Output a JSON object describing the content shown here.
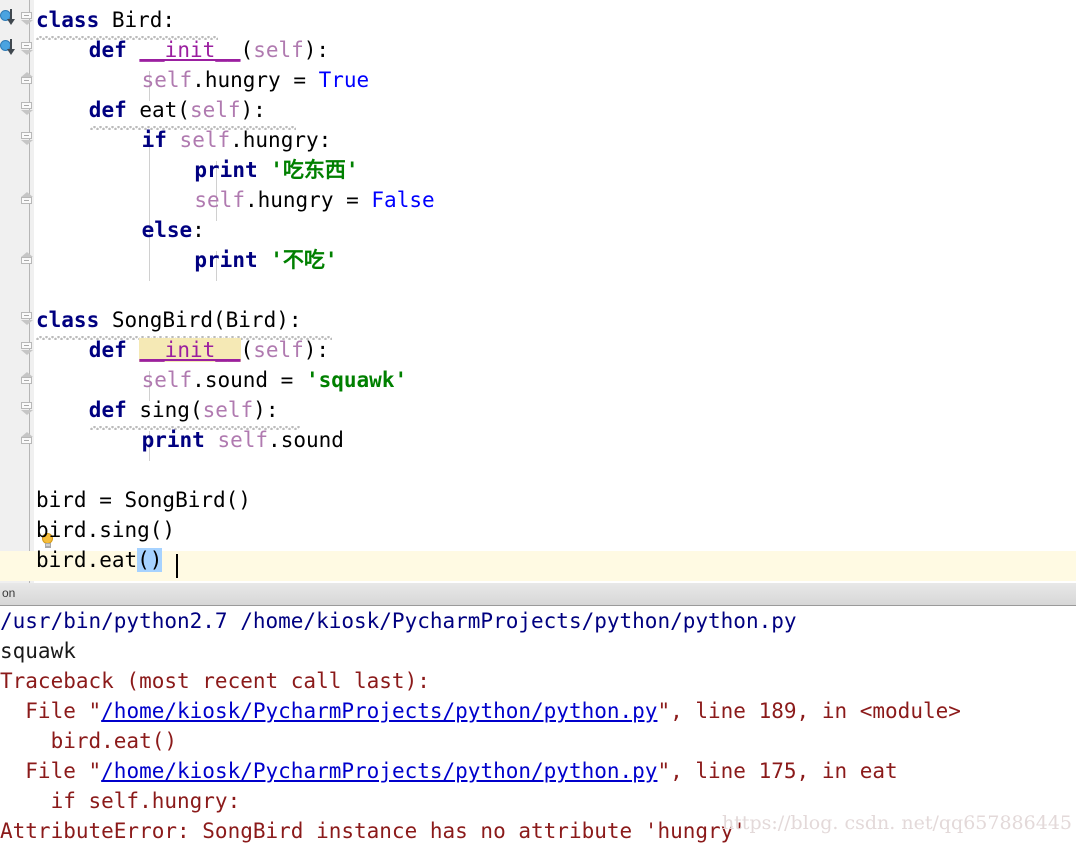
{
  "editor": {
    "language": "Python",
    "caret_row_highlight_color": "#fffae3",
    "selection_color": "#a6d2ff",
    "lines": [
      {
        "n": 1,
        "indent": 0,
        "tokens": [
          {
            "t": "class",
            "c": "kw"
          },
          {
            "t": " Bird:",
            "c": "plain"
          }
        ]
      },
      {
        "n": 2,
        "indent": 1,
        "tokens": [
          {
            "t": "def",
            "c": "kw"
          },
          {
            "t": " ",
            "c": "plain"
          },
          {
            "t": "__init__",
            "c": "dunder"
          },
          {
            "t": "(",
            "c": "plain"
          },
          {
            "t": "self",
            "c": "selfid"
          },
          {
            "t": "):",
            "c": "plain"
          }
        ]
      },
      {
        "n": 3,
        "indent": 2,
        "tokens": [
          {
            "t": "self",
            "c": "selfid"
          },
          {
            "t": ".hungry = ",
            "c": "plain"
          },
          {
            "t": "True",
            "c": "bool"
          }
        ]
      },
      {
        "n": 4,
        "indent": 1,
        "tokens": [
          {
            "t": "def",
            "c": "kw"
          },
          {
            "t": " eat(",
            "c": "plain"
          },
          {
            "t": "self",
            "c": "selfid"
          },
          {
            "t": "):",
            "c": "plain"
          }
        ]
      },
      {
        "n": 5,
        "indent": 2,
        "tokens": [
          {
            "t": "if",
            "c": "kw"
          },
          {
            "t": " ",
            "c": "plain"
          },
          {
            "t": "self",
            "c": "selfid"
          },
          {
            "t": ".hungry:",
            "c": "plain"
          }
        ]
      },
      {
        "n": 6,
        "indent": 3,
        "tokens": [
          {
            "t": "print",
            "c": "kw"
          },
          {
            "t": " ",
            "c": "plain"
          },
          {
            "t": "'吃东西'",
            "c": "str"
          }
        ]
      },
      {
        "n": 7,
        "indent": 3,
        "tokens": [
          {
            "t": "self",
            "c": "selfid"
          },
          {
            "t": ".hungry = ",
            "c": "plain"
          },
          {
            "t": "False",
            "c": "bool"
          }
        ]
      },
      {
        "n": 8,
        "indent": 2,
        "tokens": [
          {
            "t": "else",
            "c": "kw"
          },
          {
            "t": ":",
            "c": "plain"
          }
        ]
      },
      {
        "n": 9,
        "indent": 3,
        "tokens": [
          {
            "t": "print",
            "c": "kw"
          },
          {
            "t": " ",
            "c": "plain"
          },
          {
            "t": "'不吃'",
            "c": "str"
          }
        ]
      },
      {
        "n": 10,
        "indent": 0,
        "tokens": []
      },
      {
        "n": 11,
        "indent": 0,
        "tokens": [
          {
            "t": "class",
            "c": "kw"
          },
          {
            "t": " SongBird(Bird):",
            "c": "plain"
          }
        ]
      },
      {
        "n": 12,
        "indent": 1,
        "tokens": [
          {
            "t": "def",
            "c": "kw"
          },
          {
            "t": " ",
            "c": "plain"
          },
          {
            "t": "__init__",
            "c": "dunder-hl"
          },
          {
            "t": "(",
            "c": "plain"
          },
          {
            "t": "self",
            "c": "selfid"
          },
          {
            "t": "):",
            "c": "plain"
          }
        ]
      },
      {
        "n": 13,
        "indent": 2,
        "tokens": [
          {
            "t": "self",
            "c": "selfid"
          },
          {
            "t": ".sound = ",
            "c": "plain"
          },
          {
            "t": "'squawk'",
            "c": "str"
          }
        ]
      },
      {
        "n": 14,
        "indent": 1,
        "tokens": [
          {
            "t": "def",
            "c": "kw"
          },
          {
            "t": " sing(",
            "c": "plain"
          },
          {
            "t": "self",
            "c": "selfid"
          },
          {
            "t": "):",
            "c": "plain"
          }
        ]
      },
      {
        "n": 15,
        "indent": 2,
        "tokens": [
          {
            "t": "print",
            "c": "kw"
          },
          {
            "t": " ",
            "c": "plain"
          },
          {
            "t": "self",
            "c": "selfid"
          },
          {
            "t": ".sound",
            "c": "plain"
          }
        ]
      },
      {
        "n": 16,
        "indent": 0,
        "tokens": []
      },
      {
        "n": 17,
        "indent": 0,
        "tokens": [
          {
            "t": "bird = SongBird()",
            "c": "plain"
          }
        ]
      },
      {
        "n": 18,
        "indent": 0,
        "tokens": [
          {
            "t": "bird.sing()",
            "c": "plain"
          }
        ]
      },
      {
        "n": 19,
        "indent": 0,
        "tokens": [
          {
            "t": "bird.eat",
            "c": "plain"
          },
          {
            "t": "()",
            "c": "selparen"
          }
        ]
      }
    ]
  },
  "console": {
    "tab_label": "on",
    "lines": [
      {
        "segments": [
          {
            "t": "/usr/bin/python2.7 /home/kiosk/PycharmProjects/python/python.py",
            "c": "c-cmd"
          }
        ]
      },
      {
        "segments": [
          {
            "t": "squawk",
            "c": "c-out"
          }
        ]
      },
      {
        "segments": [
          {
            "t": "Traceback (most recent call last):",
            "c": "c-err"
          }
        ]
      },
      {
        "segments": [
          {
            "t": "  File \"",
            "c": "c-err"
          },
          {
            "t": "/home/kiosk/PycharmProjects/python/python.py",
            "c": "c-link"
          },
          {
            "t": "\", line 189, in <module>",
            "c": "c-err"
          }
        ]
      },
      {
        "segments": [
          {
            "t": "    bird.eat()",
            "c": "c-err"
          }
        ]
      },
      {
        "segments": [
          {
            "t": "  File \"",
            "c": "c-err"
          },
          {
            "t": "/home/kiosk/PycharmProjects/python/python.py",
            "c": "c-link"
          },
          {
            "t": "\", line 175, in eat",
            "c": "c-err"
          }
        ]
      },
      {
        "segments": [
          {
            "t": "    if self.hungry:",
            "c": "c-err"
          }
        ]
      },
      {
        "segments": [
          {
            "t": "AttributeError: SongBird instance has no attribute 'hungry'",
            "c": "c-err"
          }
        ]
      }
    ]
  },
  "watermark": {
    "text": "https://blog. csdn. net/qq657886445"
  }
}
